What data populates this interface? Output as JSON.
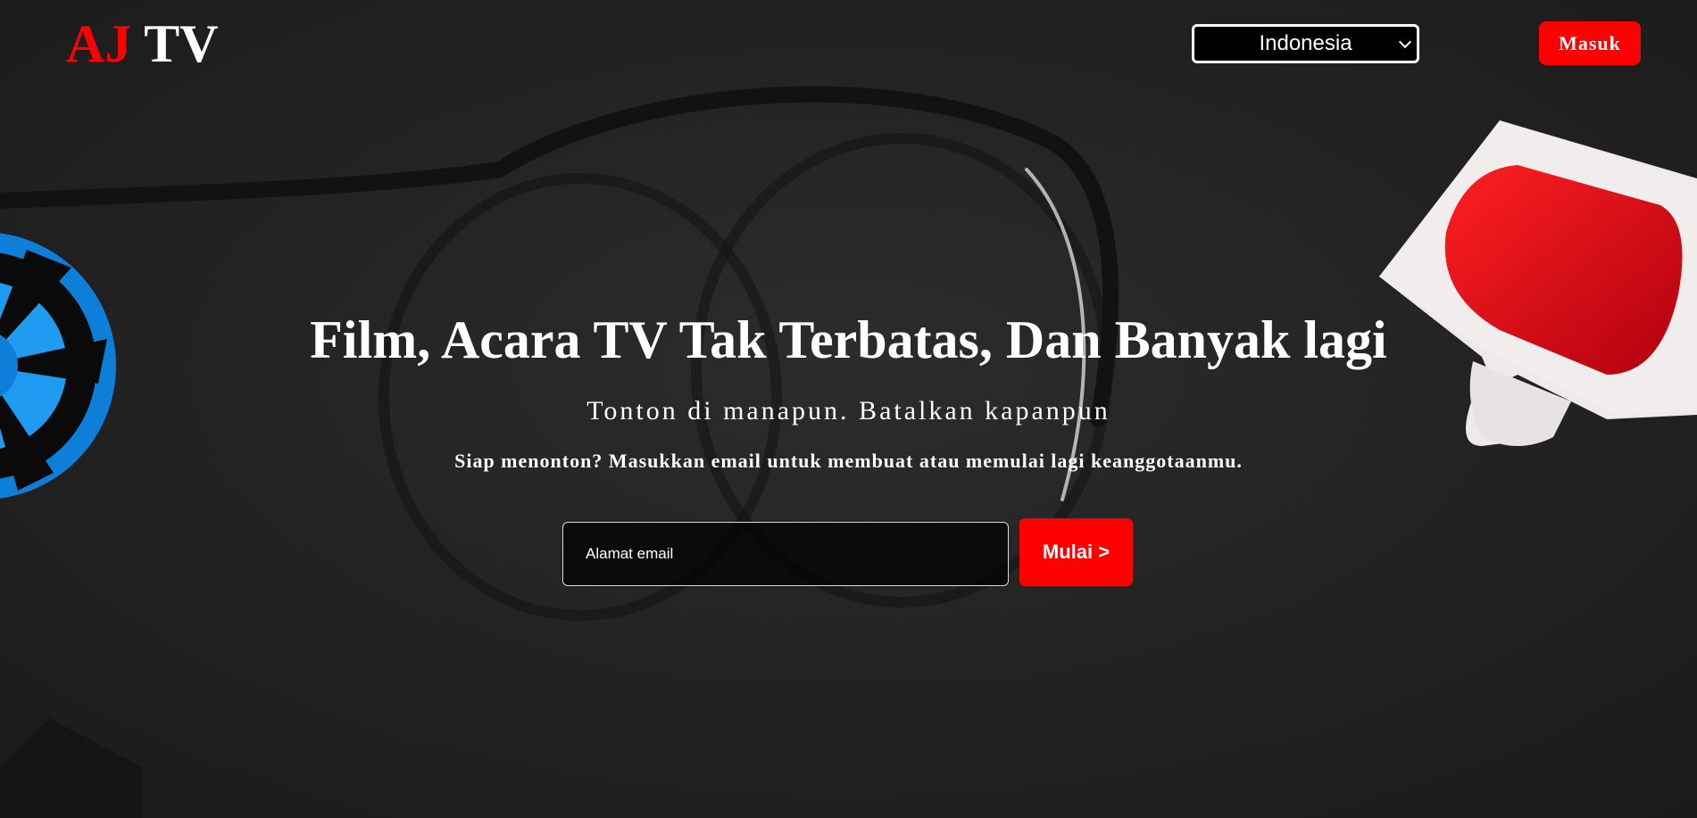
{
  "header": {
    "logo_part1": "AJ",
    "logo_part2": "TV",
    "language_selected": "Indonesia",
    "login_label": "Masuk"
  },
  "hero": {
    "title": "Film, Acara TV Tak Terbatas, Dan Banyak lagi",
    "subtitle": "Tonton di manapun. Batalkan kapanpun",
    "cta_text": "Siap menonton? Masukkan email untuk membuat atau memulai lagi keanggotaanmu.",
    "email_placeholder": "Alamat email",
    "start_label": "Mulai >"
  },
  "colors": {
    "accent": "#ff0000",
    "background": "#232323",
    "text": "#ffffff"
  },
  "icons": {
    "language_dropdown": "chevron-down-icon"
  }
}
